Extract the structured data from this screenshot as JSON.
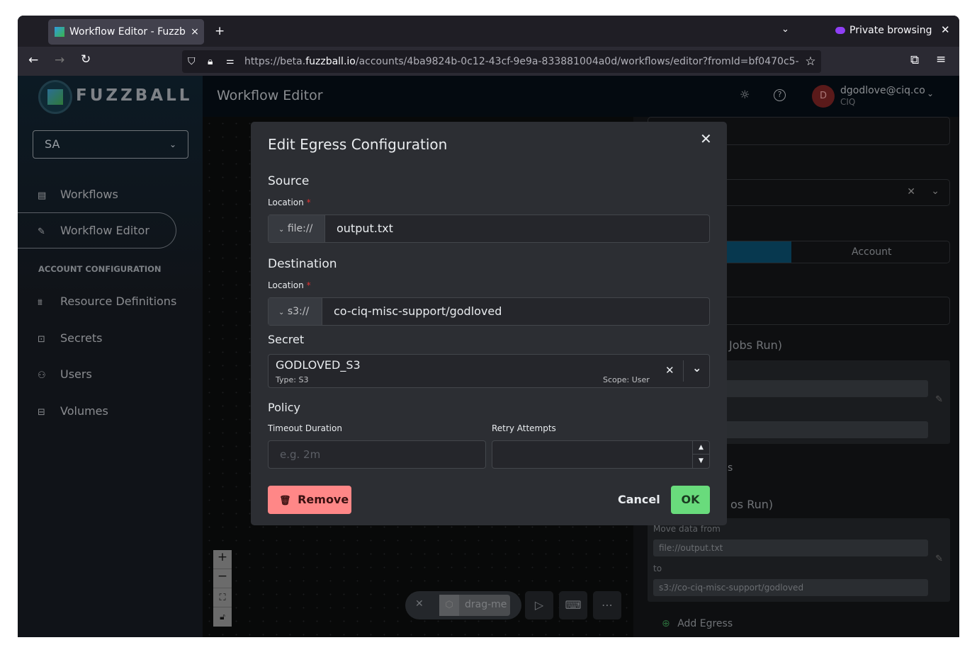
{
  "browser": {
    "tab_title": "Workflow Editor - Fuzzball",
    "url_prefix": "https://beta.",
    "url_domain": "fuzzball.io",
    "url_path": "/accounts/4ba9824b-0c12-43cf-9e9a-833881004a0d/workflows/editor?fromId=bf0470c5-",
    "private_label": "Private browsing"
  },
  "app": {
    "logo": "FUZZBALL",
    "header_title": "Workflow Editor",
    "user_email": "dgodlove@ciq.co",
    "user_org": "CIQ",
    "avatar_initial": "D",
    "avatar_color": "#6b1c1c"
  },
  "sidebar": {
    "account_select": "SA",
    "items": [
      {
        "label": "Workflows",
        "icon": "list-icon"
      },
      {
        "label": "Workflow Editor",
        "icon": "edit-icon",
        "active": true
      }
    ],
    "section_title": "ACCOUNT CONFIGURATION",
    "config_items": [
      {
        "label": "Resource Definitions",
        "icon": "hierarchy-icon"
      },
      {
        "label": "Secrets",
        "icon": "secret-icon"
      },
      {
        "label": "Users",
        "icon": "users-icon"
      },
      {
        "label": "Volumes",
        "icon": "volume-icon"
      }
    ]
  },
  "canvas": {
    "node_label": "drag-me"
  },
  "right_panel": {
    "account_tab": "Account",
    "section1_partial": "Jobs Run)",
    "section2_partial": "os Run)",
    "partial_s": "s",
    "move_from_label": "Move data from",
    "move_from_value": "file://output.txt",
    "to_label": "to",
    "to_value": "s3://co-ciq-misc-support/godloved",
    "add_egress": "Add Egress"
  },
  "modal": {
    "title": "Edit Egress Configuration",
    "source_title": "Source",
    "source_location_label": "Location",
    "source_scheme": "file://",
    "source_path": "output.txt",
    "dest_title": "Destination",
    "dest_location_label": "Location",
    "dest_scheme": "s3://",
    "dest_path": "co-ciq-misc-support/godloved",
    "secret_title": "Secret",
    "secret_name": "GODLOVED_S3",
    "secret_type": "Type: S3",
    "secret_scope": "Scope: User",
    "policy_title": "Policy",
    "timeout_label": "Timeout Duration",
    "timeout_placeholder": "e.g. 2m",
    "retry_label": "Retry Attempts",
    "retry_value": "",
    "remove_label": "Remove",
    "cancel_label": "Cancel",
    "ok_label": "OK",
    "required_mark": "*",
    "remove_color": "#ff8787",
    "ok_color": "#69db7c"
  }
}
